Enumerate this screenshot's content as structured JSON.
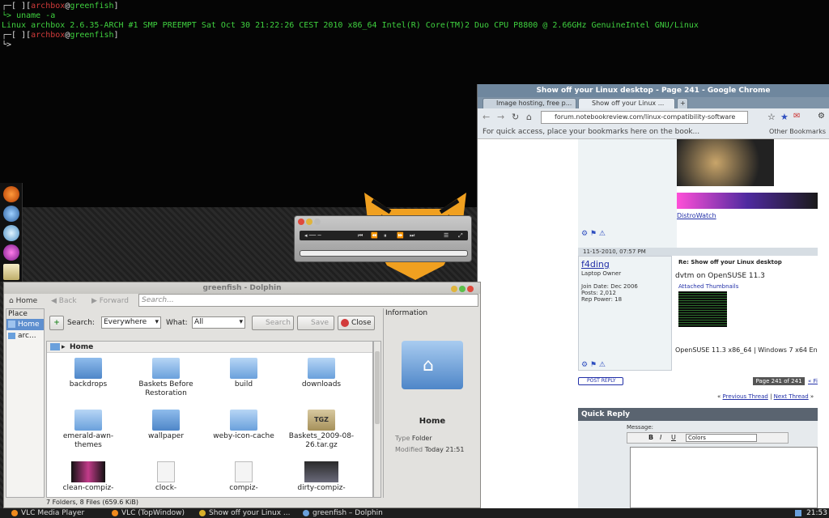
{
  "terminal": {
    "prompt_open": "[ ][",
    "user": "archbox",
    "at": "@",
    "host": "greenfish",
    "command": "uname -a",
    "output": "Linux archbox 2.6.35-ARCH #1 SMP PREEMPT Sat Oct 30 21:22:26 CEST 2010 x86_64 Intel(R) Core(TM)2 Duo CPU P8800 @ 2.66GHz GenuineIntel GNU/Linux",
    "cursor": "└>"
  },
  "chrome": {
    "title": "Show off your Linux desktop - Page 241 - Google Chrome",
    "tabs": [
      {
        "label": "Image hosting, free p..."
      },
      {
        "label": "Show off your Linux ..."
      }
    ],
    "url": "forum.notebookreview.com/linux-compatibility-software",
    "bookmarks_hint": "For quick access, place your bookmarks here on the book...",
    "other_bookmarks": "Other Bookmarks",
    "distrowatch_link": "DistroWatch",
    "post_date": "11-15-2010, 07:57 PM",
    "username": "f4ding",
    "user_title": "Laptop Owner",
    "join_date": "Join Date: Dec 2006",
    "posts": "Posts: 2,012",
    "rep_power": "Rep Power: 18",
    "post_title": "Re: Show off your Linux desktop",
    "post_body": "dvtm on OpenSUSE 11.3",
    "attached": "Attached Thumbnails",
    "signature": "OpenSUSE 11.3 x86_64 | Windows 7 x64 En",
    "post_reply": "POST REPLY",
    "page_of": "Page 241 of 241",
    "page_first": "« Fi",
    "prev_thread": "Previous Thread",
    "next_thread": "Next Thread",
    "nav_sep": "|",
    "nav_left": "«",
    "nav_right": "»",
    "quick_reply": "Quick Reply",
    "message_label": "Message:",
    "colors_select": "Colors"
  },
  "dolphin": {
    "title": "greenfish - Dolphin",
    "nav": {
      "home": "Home",
      "back": "Back",
      "forward": "Forward"
    },
    "search_placeholder": "Search...",
    "places": {
      "title": "Place",
      "items": [
        {
          "label": "Home"
        },
        {
          "label": "arc..."
        }
      ]
    },
    "searchbar": {
      "search_label": "Search:",
      "search_value": "Everywhere",
      "what_label": "What:",
      "what_value": "All",
      "search_button": "Search",
      "save_button": "Save",
      "close_button": "Close"
    },
    "breadcrumb": "Home",
    "files": [
      {
        "name": "backdrops"
      },
      {
        "name": "Baskets Before Restoration"
      },
      {
        "name": "build"
      },
      {
        "name": "downloads"
      },
      {
        "name": "emerald-awn-themes"
      },
      {
        "name": "wallpaper"
      },
      {
        "name": "weby-icon-cache"
      },
      {
        "name": "Baskets_2009-08-26.tar.gz"
      },
      {
        "name": "clean-compiz-"
      },
      {
        "name": "clock-"
      },
      {
        "name": "compiz-"
      },
      {
        "name": "dirty-compiz-"
      }
    ],
    "tgz_label": "TGZ",
    "info": {
      "title": "Information",
      "name": "Home",
      "type_label": "Type",
      "type_value": "Folder",
      "modified_label": "Modified",
      "modified_value": "Today 21:51"
    },
    "status": "7 Folders, 8 Files (659.6 KiB)"
  },
  "taskbar": {
    "items": [
      {
        "label": "VLC Media Player"
      },
      {
        "label": "VLC (TopWindow)"
      },
      {
        "label": "Show off your Linux ..."
      },
      {
        "label": "greenfish – Dolphin"
      }
    ],
    "clock": "21:53"
  },
  "colors": {
    "accent": "#5e8fcf",
    "folder": "#6aa0dc",
    "terminal_user": "#d23b3b",
    "terminal_host": "#3fd13f"
  }
}
